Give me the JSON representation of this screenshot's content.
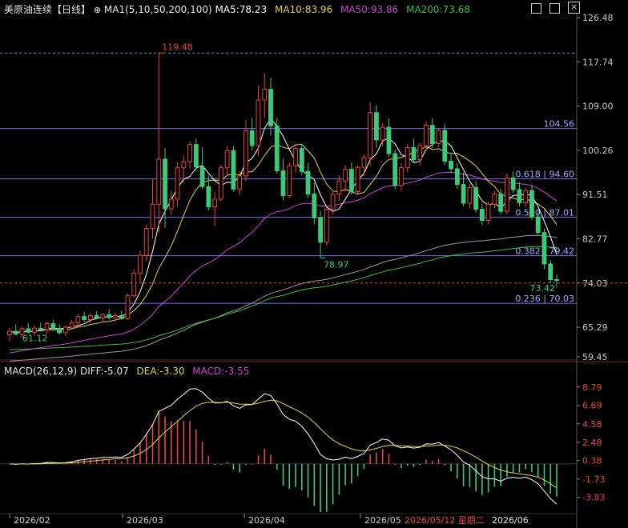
{
  "header": {
    "title": "美原油连续",
    "period": "【日线】",
    "ma_label": "MA1(5,10,50,200,100)",
    "ma5": "MA5:78.23",
    "ma10": "MA10:83.96",
    "ma50": "MA50:93.86",
    "ma200": "MA200:73.68"
  },
  "macd_header": {
    "label": "MACD(26,12,9)",
    "diff": "DIFF:-5.07",
    "dea": "DEA:-3.30",
    "macd": "MACD:-3.55"
  },
  "colors": {
    "up": "#e8443a",
    "down": "#3ec97a",
    "ma5": "#ffffff",
    "ma10": "#e5d24a",
    "ma50": "#d13fd6",
    "ma200": "#3fbf3f",
    "ma100": "#999999",
    "fib": "#6f6ff0"
  },
  "chart_data": [
    {
      "type": "candlestick",
      "y_ticks": [
        "126.48",
        "117.74",
        "109.00",
        "100.26",
        "91.51",
        "82.77",
        "74.03",
        "65.29",
        "59.45"
      ],
      "ylim": [
        59.45,
        126.48
      ],
      "x_ticks": [
        "2026/02",
        "2026/03",
        "2026/04",
        "2026/05",
        "2026/06"
      ],
      "cursor_label": "2026/05/12 星期二",
      "current_price": 74.03,
      "high_label": "119.48",
      "low_label": "78.97",
      "min_label": "61.12",
      "ma_end_label": "73.42",
      "fib_levels": [
        {
          "label": "104.56",
          "value": 104.56
        },
        {
          "label": "0.618 | 94.60",
          "value": 94.6
        },
        {
          "label": "0.500 | 87.01",
          "value": 87.01
        },
        {
          "label": "0.382 | 79.42",
          "value": 79.42
        },
        {
          "label": "0.236 | 70.03",
          "value": 70.03
        }
      ],
      "high_line": 119.48,
      "candles": [
        [
          63.8,
          65.2,
          62.5,
          64.5
        ],
        [
          64.5,
          65.8,
          63.7,
          63.9
        ],
        [
          63.9,
          65.4,
          63.2,
          65.0
        ],
        [
          65.0,
          66.1,
          64.1,
          64.3
        ],
        [
          64.3,
          65.7,
          63.5,
          65.1
        ],
        [
          65.1,
          66.2,
          64.6,
          64.8
        ],
        [
          64.8,
          66.4,
          64.0,
          66.0
        ],
        [
          66.0,
          66.8,
          64.7,
          65.0
        ],
        [
          65.0,
          65.9,
          63.8,
          64.2
        ],
        [
          64.2,
          65.6,
          63.6,
          65.3
        ],
        [
          65.3,
          66.7,
          64.8,
          66.2
        ],
        [
          66.2,
          67.9,
          65.7,
          67.4
        ],
        [
          67.4,
          68.3,
          66.4,
          66.8
        ],
        [
          66.8,
          68.1,
          66.1,
          67.6
        ],
        [
          67.6,
          68.5,
          66.9,
          67.1
        ],
        [
          67.1,
          68.1,
          66.3,
          67.8
        ],
        [
          67.8,
          68.9,
          66.8,
          67.2
        ],
        [
          67.2,
          68.2,
          66.4,
          67.6
        ],
        [
          67.6,
          68.6,
          66.8,
          67.0
        ],
        [
          67.0,
          72.0,
          66.8,
          71.5
        ],
        [
          71.5,
          76.8,
          71.1,
          76.0
        ],
        [
          76.0,
          80.5,
          74.2,
          79.5
        ],
        [
          79.5,
          85.6,
          78.3,
          84.8
        ],
        [
          84.8,
          94.5,
          82.8,
          89.6
        ],
        [
          89.6,
          119.5,
          84.0,
          98.5
        ],
        [
          98.5,
          100.7,
          85.0,
          88.7
        ],
        [
          88.7,
          92.3,
          87.4,
          90.6
        ],
        [
          90.6,
          97.9,
          89.1,
          96.8
        ],
        [
          96.8,
          99.2,
          93.9,
          98.0
        ],
        [
          98.0,
          102.1,
          96.7,
          101.4
        ],
        [
          101.4,
          102.6,
          96.2,
          97.0
        ],
        [
          97.0,
          100.9,
          92.6,
          93.1
        ],
        [
          93.1,
          95.3,
          88.4,
          89.1
        ],
        [
          89.1,
          92.1,
          85.3,
          90.6
        ],
        [
          90.6,
          97.4,
          90.1,
          96.8
        ],
        [
          96.8,
          101.1,
          95.3,
          100.2
        ],
        [
          100.2,
          101.1,
          92.1,
          92.6
        ],
        [
          92.6,
          96.1,
          91.4,
          95.2
        ],
        [
          95.2,
          106.2,
          94.1,
          104.1
        ],
        [
          104.1,
          106.7,
          100.2,
          101.2
        ],
        [
          101.2,
          113.0,
          99.1,
          110.2
        ],
        [
          110.2,
          115.5,
          106.7,
          112.3
        ],
        [
          112.3,
          114.6,
          103.2,
          105.1
        ],
        [
          105.1,
          106.7,
          95.6,
          96.2
        ],
        [
          96.2,
          98.5,
          90.4,
          91.3
        ],
        [
          91.3,
          97.9,
          90.8,
          97.2
        ],
        [
          97.2,
          101.3,
          95.9,
          100.6
        ],
        [
          100.6,
          101.5,
          95.3,
          96.1
        ],
        [
          96.1,
          97.8,
          90.8,
          91.6
        ],
        [
          91.6,
          93.9,
          85.6,
          86.9
        ],
        [
          86.9,
          88.3,
          79.0,
          82.1
        ],
        [
          82.1,
          89.1,
          81.4,
          88.6
        ],
        [
          88.6,
          92.3,
          87.5,
          91.6
        ],
        [
          91.6,
          95.3,
          90.3,
          94.2
        ],
        [
          94.2,
          97.4,
          92.1,
          96.5
        ],
        [
          96.5,
          97.9,
          91.5,
          92.1
        ],
        [
          92.1,
          97.3,
          91.4,
          96.9
        ],
        [
          96.9,
          99.5,
          95.1,
          98.8
        ],
        [
          98.8,
          109.8,
          97.2,
          107.7
        ],
        [
          107.7,
          109.2,
          100.7,
          102.3
        ],
        [
          102.3,
          105.6,
          101.1,
          104.8
        ],
        [
          104.8,
          106.6,
          98.9,
          99.6
        ],
        [
          99.6,
          100.4,
          92.5,
          93.3
        ],
        [
          93.3,
          97.7,
          92.1,
          96.8
        ],
        [
          96.8,
          101.5,
          95.9,
          100.8
        ],
        [
          100.8,
          102.6,
          97.8,
          98.4
        ],
        [
          98.4,
          101.7,
          97.2,
          101.2
        ],
        [
          101.2,
          106.0,
          100.1,
          105.2
        ],
        [
          105.2,
          106.6,
          100.7,
          101.6
        ],
        [
          101.6,
          104.6,
          100.9,
          104.2
        ],
        [
          104.2,
          105.5,
          97.4,
          98.1
        ],
        [
          98.1,
          99.5,
          95.7,
          96.6
        ],
        [
          96.6,
          97.8,
          92.6,
          93.5
        ],
        [
          93.5,
          95.9,
          89.2,
          89.8
        ],
        [
          89.8,
          93.6,
          88.8,
          92.9
        ],
        [
          92.9,
          94.2,
          88.0,
          88.6
        ],
        [
          88.6,
          89.7,
          85.5,
          86.4
        ],
        [
          86.4,
          90.1,
          85.6,
          89.6
        ],
        [
          89.6,
          92.3,
          88.8,
          91.6
        ],
        [
          91.6,
          92.7,
          87.6,
          88.2
        ],
        [
          88.2,
          95.7,
          87.6,
          94.8
        ],
        [
          94.8,
          96.1,
          91.8,
          92.5
        ],
        [
          92.5,
          94.0,
          89.2,
          89.9
        ],
        [
          89.9,
          92.9,
          89.0,
          92.3
        ],
        [
          92.3,
          93.5,
          86.5,
          87.1
        ],
        [
          87.1,
          88.3,
          83.4,
          84.0
        ],
        [
          84.0,
          84.8,
          76.8,
          77.8
        ],
        [
          77.8,
          78.6,
          74.0,
          74.7
        ],
        [
          74.7,
          75.7,
          73.4,
          74.6
        ]
      ]
    },
    {
      "type": "bar+line",
      "name": "MACD",
      "y_ticks": [
        "8.79",
        "6.69",
        "4.58",
        "2.48",
        "0.38",
        "-1.73",
        "-3.83"
      ],
      "ylim": [
        -5.5,
        9.5
      ]
    }
  ]
}
